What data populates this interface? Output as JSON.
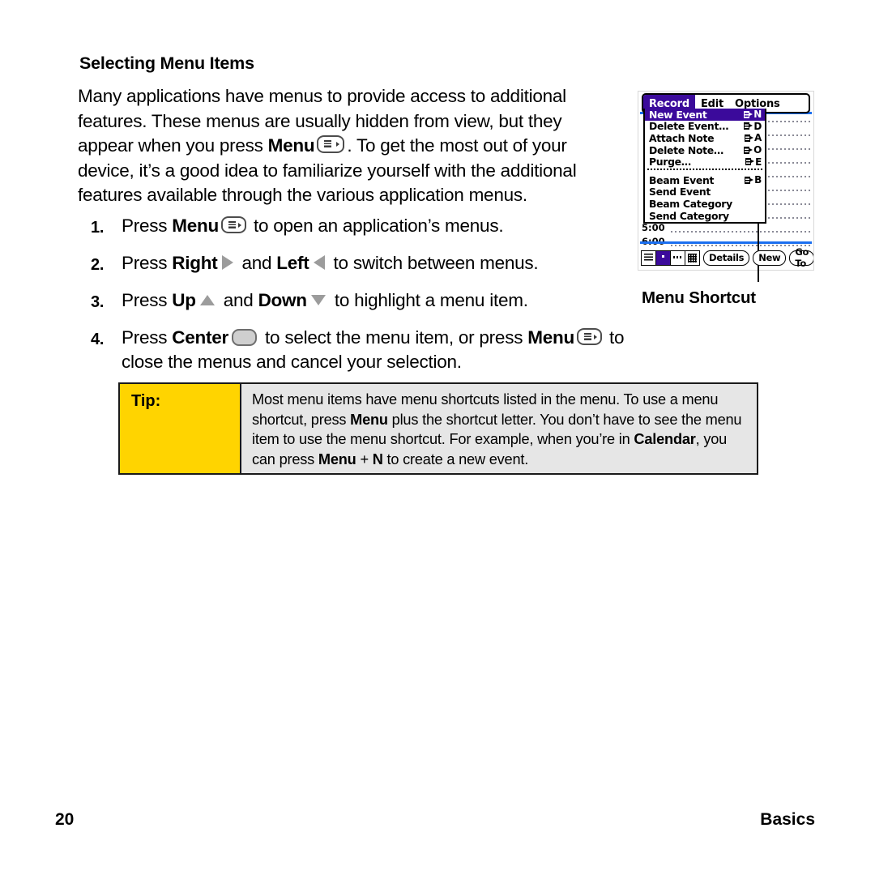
{
  "page": {
    "heading": "Selecting Menu Items",
    "intro_part1": "Many applications have menus to provide access to additional features. These menus are usually hidden from view, but they appear when you press ",
    "intro_menu_bold": "Menu",
    "intro_part2": ". To get the most out of your device, it’s a good idea to familiarize yourself with the additional features available through the various application menus."
  },
  "steps": [
    {
      "num": "1.",
      "pre": "Press ",
      "bold": "Menu",
      "icon": "menu-key-icon",
      "post": " to open an application’s menus."
    },
    {
      "num": "2.",
      "pre": "Press ",
      "bold": "Right",
      "icon": "right-arrow-icon",
      "mid": " and ",
      "bold2": "Left",
      "icon2": "left-arrow-icon",
      "post": " to switch between menus."
    },
    {
      "num": "3.",
      "pre": "Press ",
      "bold": "Up",
      "icon": "up-arrow-icon",
      "mid": " and ",
      "bold2": "Down",
      "icon2": "down-arrow-icon",
      "post": " to highlight a menu item."
    },
    {
      "num": "4.",
      "pre": "Press ",
      "bold": "Center",
      "icon": "center-key-icon",
      "mid": " to select the menu item, or press ",
      "bold2": "Menu",
      "icon2": "menu-key-icon",
      "post": " to close the menus and cancel your selection."
    }
  ],
  "tip": {
    "label": "Tip:",
    "line1_a": "Most menu items have menu shortcuts listed in the menu. To use a menu shortcut, press ",
    "line1_b": "Menu",
    "line1_c": " plus the shortcut letter. You don’t have to see the menu item to use the menu shortcut. For example, when you’re in ",
    "line1_d": "Calendar",
    "line1_e": ", you can press ",
    "line1_f": "Menu",
    "line1_g": " + ",
    "line1_h": "N",
    "line1_i": " to create a new event."
  },
  "device": {
    "menubar": [
      {
        "label": "Record",
        "active": true
      },
      {
        "label": "Edit",
        "active": false
      },
      {
        "label": "Options",
        "active": false
      }
    ],
    "menu_items": [
      {
        "label": "New Event",
        "shortcut": "N",
        "selected": true,
        "separator_after": false
      },
      {
        "label": "Delete Event…",
        "shortcut": "D",
        "selected": false,
        "separator_after": false
      },
      {
        "label": "Attach Note",
        "shortcut": "A",
        "selected": false,
        "separator_after": false
      },
      {
        "label": "Delete Note…",
        "shortcut": "O",
        "selected": false,
        "separator_after": false
      },
      {
        "label": "Purge…",
        "shortcut": "E",
        "selected": false,
        "separator_after": true
      },
      {
        "label": "Beam Event",
        "shortcut": "B",
        "selected": false,
        "separator_after": false
      },
      {
        "label": "Send Event",
        "shortcut": "",
        "selected": false,
        "separator_after": false
      },
      {
        "label": "Beam Category",
        "shortcut": "",
        "selected": false,
        "separator_after": false
      },
      {
        "label": "Send Category",
        "shortcut": "",
        "selected": false,
        "separator_after": false
      }
    ],
    "time_rows": [
      "",
      "",
      "",
      "",
      "",
      "",
      "",
      "",
      "5:00",
      "6:00"
    ],
    "view_icons": [
      {
        "name": "agenda-view-icon",
        "active": false
      },
      {
        "name": "day-view-icon",
        "active": true
      },
      {
        "name": "week-view-icon",
        "active": false
      },
      {
        "name": "month-view-icon",
        "active": false
      }
    ],
    "buttons": [
      "Details",
      "New",
      "Go To"
    ],
    "colors": {
      "menu_highlight": "#3b0a9b",
      "rule_blue": "#1b6ff0",
      "tip_yellow": "#ffd400",
      "tip_gray": "#e6e6e6"
    }
  },
  "callout": {
    "label": "Menu Shortcut"
  },
  "footer": {
    "page_number": "20",
    "section": "Basics"
  }
}
